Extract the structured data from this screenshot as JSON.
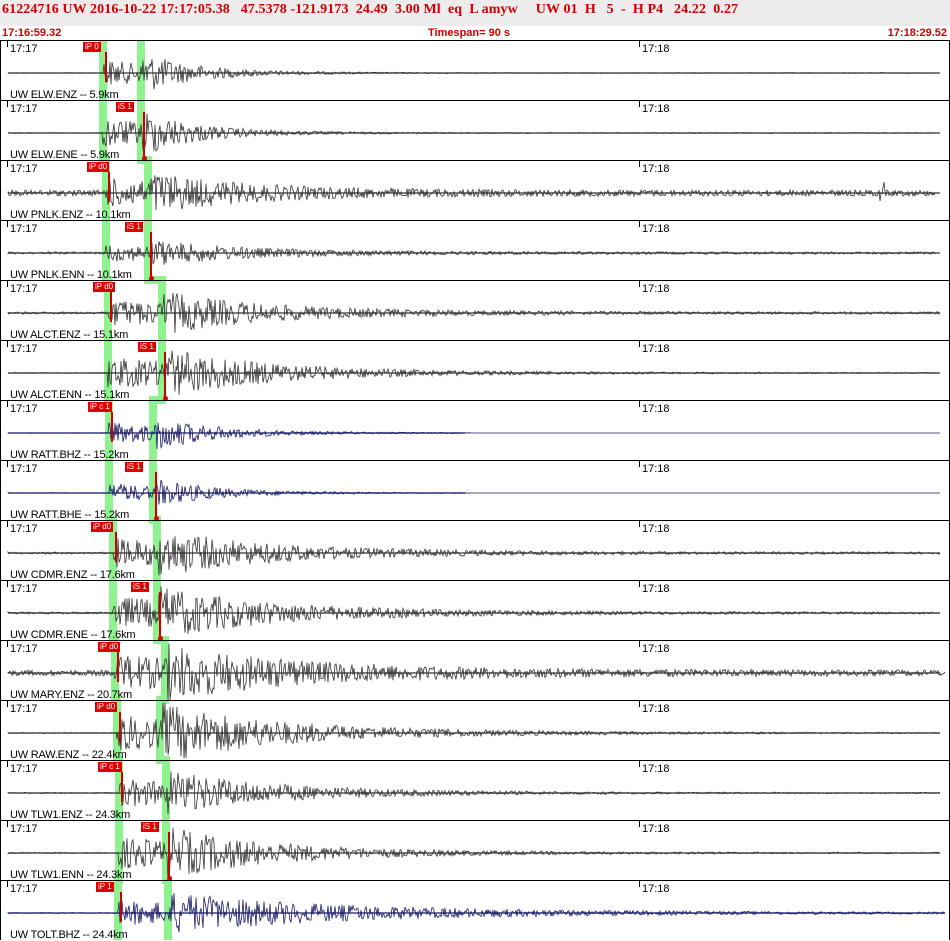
{
  "header": {
    "title": "61224716 UW 2016-10-22 17:17:05.38   47.5378 -121.9173  24.49  3.00 Ml  eq  L amyw     UW 01  H   5  -  H P4   24.22  0.27",
    "start_time": "17:16:59.32",
    "timespan": "Timespan=  90 s",
    "end_time": "17:18:29.52"
  },
  "colors": {
    "header_bg": "#ececec",
    "header_text": "#cc0000",
    "trace_dark": "#333333",
    "trace_blue": "#1a1a66",
    "pick": "#e00000",
    "arrival_band": "#8ef28e"
  },
  "time_labels": {
    "left": "17:17",
    "right": "17:18"
  },
  "channels": [
    {
      "station_label": "UW ELW.ENZ -- 5.9km",
      "pick_label": "iP 0",
      "color": "dark",
      "pick_side": "left"
    },
    {
      "station_label": "UW ELW.ENE -- 5.9km",
      "pick_label": "iS 1",
      "color": "dark",
      "pick_side": "right"
    },
    {
      "station_label": "UW PNLK.ENZ -- 10.1km",
      "pick_label": "iP d0",
      "color": "dark",
      "pick_side": "left"
    },
    {
      "station_label": "UW PNLK.ENN -- 10.1km",
      "pick_label": "iS 1",
      "color": "dark",
      "pick_side": "right"
    },
    {
      "station_label": "UW ALCT.ENZ -- 15.1km",
      "pick_label": "iP d0",
      "color": "dark",
      "pick_side": "left"
    },
    {
      "station_label": "UW ALCT.ENN -- 15.1km",
      "pick_label": "iS 1",
      "color": "dark",
      "pick_side": "right"
    },
    {
      "station_label": "UW RATT.BHZ -- 15.2km",
      "pick_label": "iP c 1",
      "color": "blue",
      "pick_side": "left"
    },
    {
      "station_label": "UW RATT.BHE -- 15.2km",
      "pick_label": "iS 1",
      "color": "blue",
      "pick_side": "right"
    },
    {
      "station_label": "UW CDMR.ENZ -- 17.6km",
      "pick_label": "iP d0",
      "color": "dark",
      "pick_side": "left"
    },
    {
      "station_label": "UW CDMR.ENE -- 17.6km",
      "pick_label": "iS 1",
      "color": "dark",
      "pick_side": "right"
    },
    {
      "station_label": "UW MARY.ENZ -- 20.7km",
      "pick_label": "iP d0",
      "color": "dark",
      "pick_side": "left"
    },
    {
      "station_label": "UW RAW.ENZ -- 22.4km",
      "pick_label": "iP d0",
      "color": "dark",
      "pick_side": "left"
    },
    {
      "station_label": "UW TLW1.ENZ -- 24.3km",
      "pick_label": "iP c 1",
      "color": "dark",
      "pick_side": "left"
    },
    {
      "station_label": "UW TLW1.ENN -- 24.3km",
      "pick_label": "iS 1",
      "color": "dark",
      "pick_side": "right"
    },
    {
      "station_label": "UW TOLT.BHZ -- 24.4km",
      "pick_label": "iP 1",
      "color": "blue",
      "pick_side": "left"
    }
  ]
}
